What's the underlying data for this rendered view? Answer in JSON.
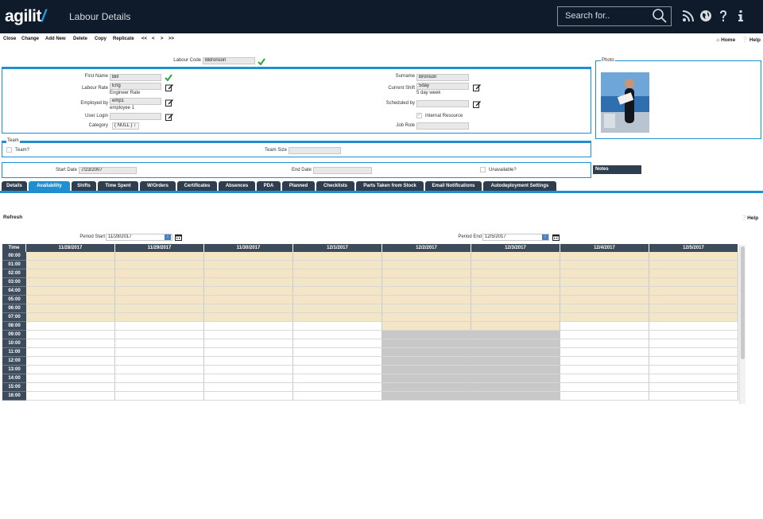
{
  "header": {
    "logo_main": "agilit",
    "logo_slash": "/",
    "title": "Labour Details",
    "search_placeholder": "Search for.."
  },
  "toolbar": {
    "items": [
      "Close",
      "Change",
      "Add New",
      "Delete",
      "Copy",
      "Replicate",
      "<<",
      "<",
      ">",
      ">>"
    ],
    "home": "Home",
    "help": "Help"
  },
  "form": {
    "labour_code_label": "Labour Code",
    "labour_code": "BBronson",
    "first_name_label": "First Name",
    "first_name": "Bill",
    "labour_rate_label": "Labour Rate",
    "labour_rate": "Eng",
    "labour_rate_desc": "Engineer Rate",
    "employed_by_label": "Employed by",
    "employed_by": "emp1",
    "employed_by_desc": "employee 1",
    "user_login_label": "User Login",
    "user_login": "",
    "category_label": "Category",
    "category": "( NULL )",
    "surname_label": "Surname",
    "surname": "Bronson",
    "current_shift_label": "Current Shift",
    "current_shift": "5day",
    "current_shift_desc": "5 day week",
    "scheduled_by_label": "Scheduled by",
    "scheduled_by": "",
    "internal_resource_label": "Internal Resource",
    "job_role_label": "Job Role",
    "job_role": "",
    "photo_label": "Photo"
  },
  "team": {
    "title": "Team",
    "team_label": "Team?",
    "team_size_label": "Team Size",
    "team_size": ""
  },
  "dates": {
    "start_label": "Start Date",
    "start": "7/23/2007",
    "end_label": "End Date",
    "end": "",
    "unavailable_label": "Unavailable?",
    "notes": "Notes"
  },
  "tabs": [
    "Details",
    "Availability",
    "Shifts",
    "Time Spent",
    "W/Orders",
    "Certificates",
    "Absences",
    "PDA",
    "Planned",
    "Checklists",
    "Parts Taken from Stock",
    "Email Notifications",
    "Autodeployment Settings"
  ],
  "availability": {
    "refresh": "Refresh",
    "help": "Help",
    "period_start_label": "Period Start",
    "period_start": "11/28/2017",
    "period_end_label": "Period End",
    "period_end": "12/5/2017",
    "time_header": "Time",
    "days": [
      "11/28/2017",
      "11/29/2017",
      "11/30/2017",
      "12/1/2017",
      "12/2/2017",
      "12/3/2017",
      "12/4/2017",
      "12/5/2017"
    ],
    "times": [
      "00:00",
      "01:00",
      "02:00",
      "03:00",
      "04:00",
      "05:00",
      "06:00",
      "07:00",
      "08:00",
      "09:00",
      "10:00",
      "11:00",
      "12:00",
      "13:00",
      "14:00",
      "15:00",
      "16:00"
    ]
  },
  "colors": {
    "header_bg": "#0f1b2a",
    "accent": "#1f8fd1",
    "tab_bg": "#2e3e4f",
    "available": "#f2e6c6",
    "blocked": "#c8c8c8",
    "tick": "#2aa83a"
  }
}
